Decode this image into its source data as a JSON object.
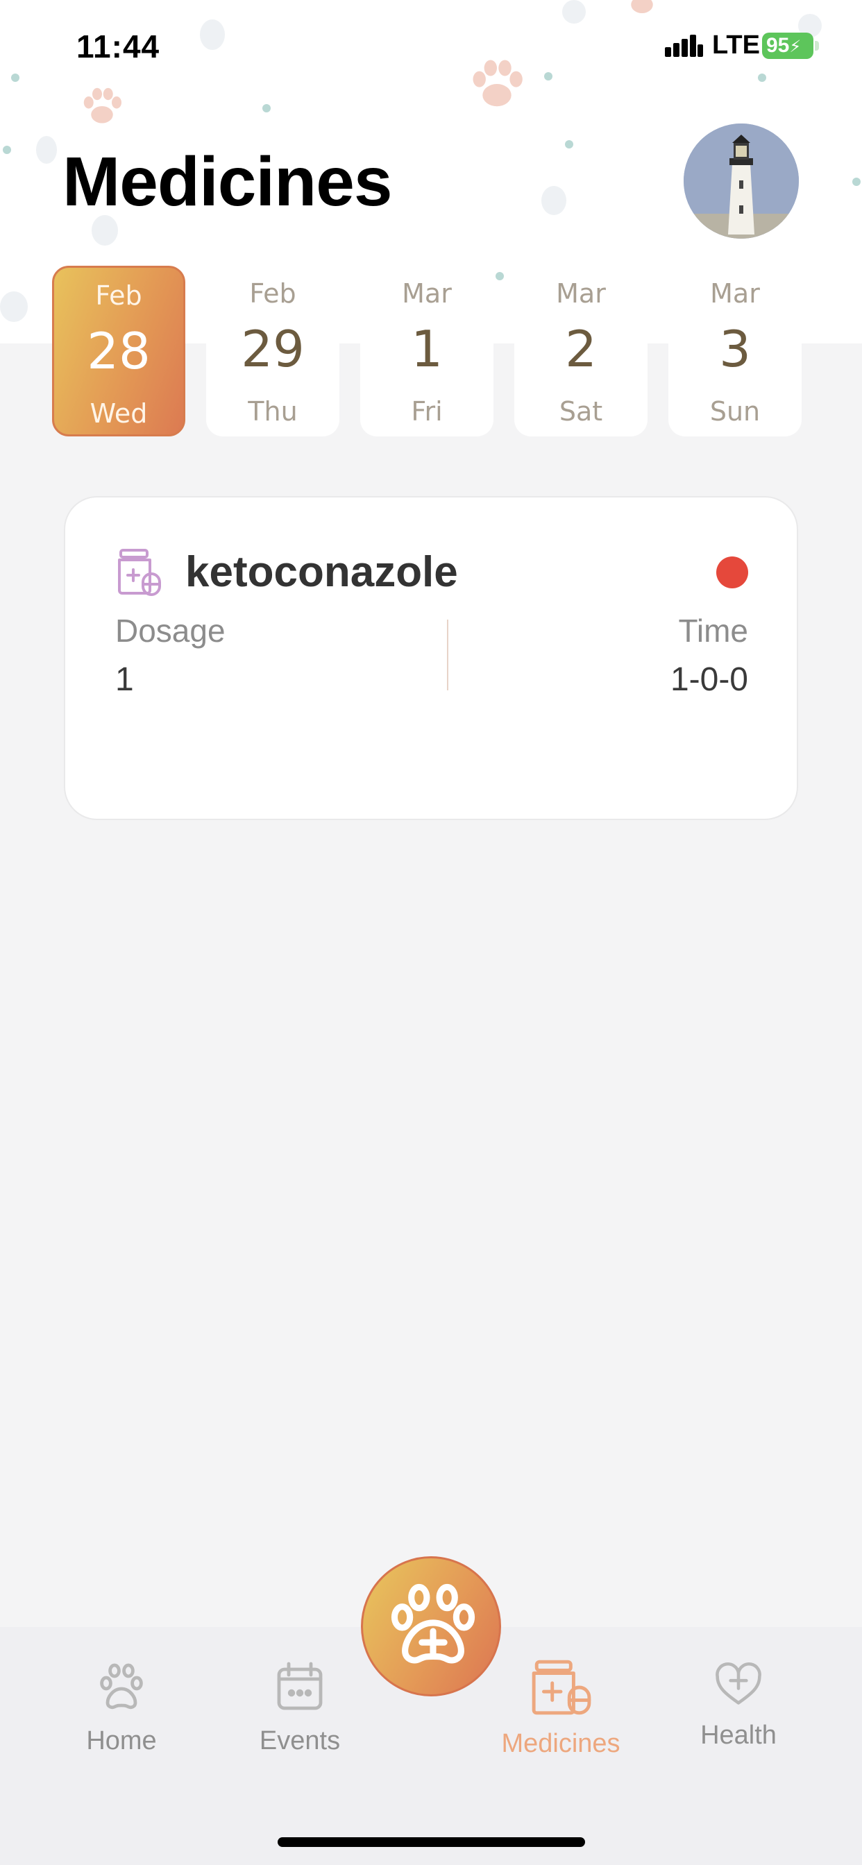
{
  "status_bar": {
    "time": "11:44",
    "network": "LTE",
    "battery": "95"
  },
  "header": {
    "title": "Medicines",
    "avatar_icon": "lighthouse-photo"
  },
  "dates": [
    {
      "month": "Feb",
      "day": "28",
      "weekday": "Wed",
      "selected": true
    },
    {
      "month": "Feb",
      "day": "29",
      "weekday": "Thu",
      "selected": false
    },
    {
      "month": "Mar",
      "day": "1",
      "weekday": "Fri",
      "selected": false
    },
    {
      "month": "Mar",
      "day": "2",
      "weekday": "Sat",
      "selected": false
    },
    {
      "month": "Mar",
      "day": "3",
      "weekday": "Sun",
      "selected": false
    }
  ],
  "medicine": {
    "name": "ketoconazole",
    "dosage_label": "Dosage",
    "dosage_value": "1",
    "time_label": "Time",
    "time_value": "1-0-0",
    "status_color": "#e5483b",
    "icon": "medicine-bottle-icon"
  },
  "nav": {
    "items": [
      {
        "label": "Home",
        "icon": "paw-icon"
      },
      {
        "label": "Events",
        "icon": "calendar-icon"
      },
      {
        "label": "Medicines",
        "icon": "medicine-icon"
      },
      {
        "label": "Health",
        "icon": "heart-plus-icon"
      }
    ],
    "active": "Medicines",
    "fab_icon": "paw-plus-icon"
  },
  "colors": {
    "accent": "#e39a55",
    "active_nav": "#eda77e",
    "background": "#f4f4f5"
  }
}
